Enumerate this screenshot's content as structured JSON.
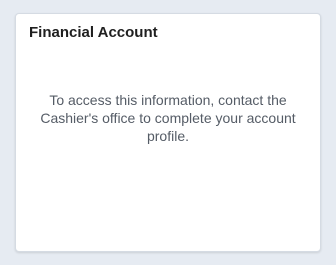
{
  "tile": {
    "title": "Financial Account",
    "message": "To access this information, contact the Cashier's office to complete your account profile."
  }
}
